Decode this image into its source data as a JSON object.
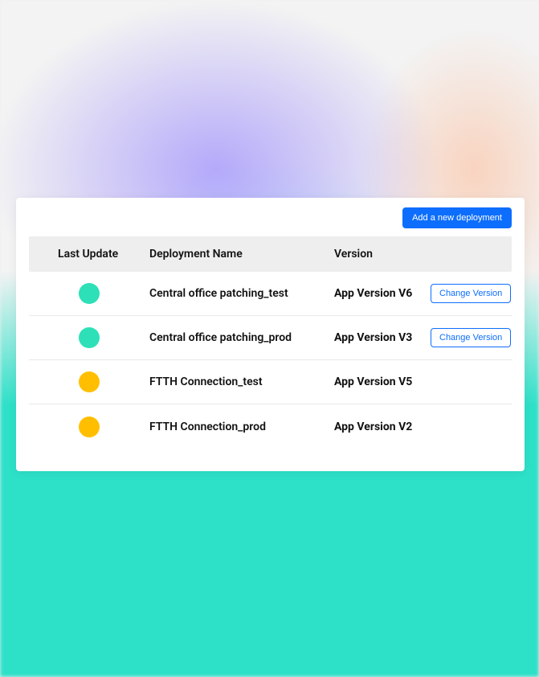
{
  "toolbar": {
    "add_button": "Add a new deployment"
  },
  "columns": {
    "update": "Last Update",
    "name": "Deployment Name",
    "version": "Version"
  },
  "change_version_label": "Change Version",
  "rows": [
    {
      "status": "green",
      "name": "Central office patching_test",
      "version": "App Version V6",
      "action": true
    },
    {
      "status": "green",
      "name": "Central office patching_prod",
      "version": "App Version V3",
      "action": true
    },
    {
      "status": "amber",
      "name": "FTTH Connection_test",
      "version": "App Version V5",
      "action": false
    },
    {
      "status": "amber",
      "name": "FTTH Connection_prod",
      "version": "App Version V2",
      "action": false
    }
  ]
}
